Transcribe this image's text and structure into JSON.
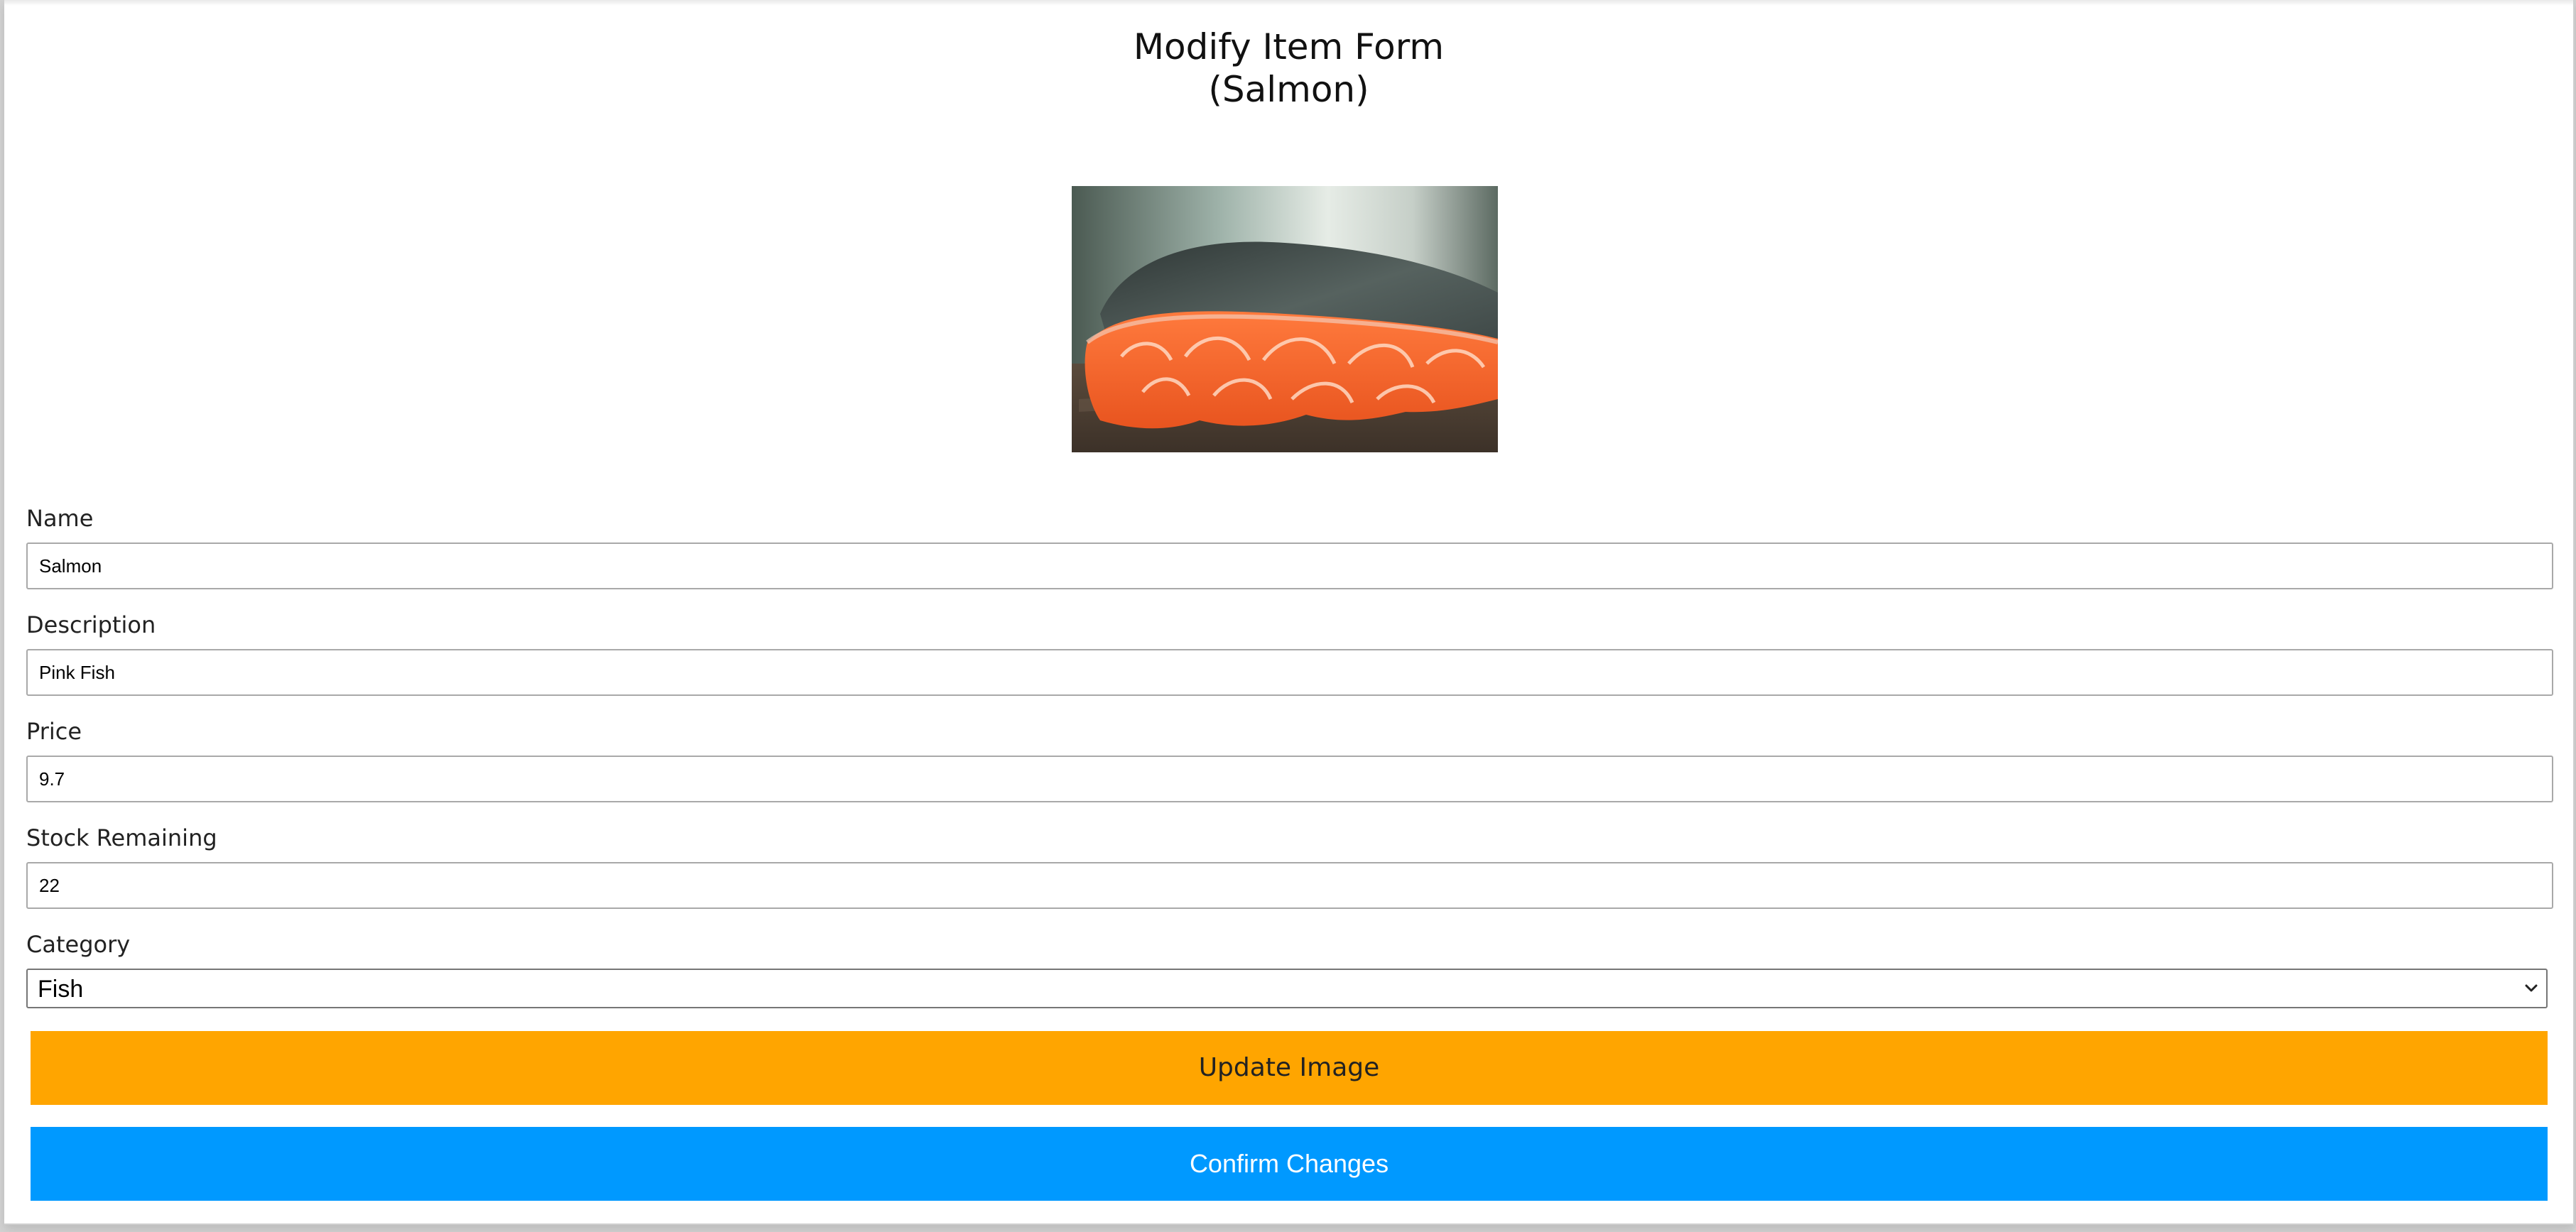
{
  "form": {
    "title_line1": "Modify Item Form",
    "title_line2": "(Salmon)",
    "image_alt": "Salmon",
    "fields": [
      {
        "label": "Name",
        "value": "Salmon"
      },
      {
        "label": "Description",
        "value": "Pink Fish"
      },
      {
        "label": "Price",
        "value": "9.7"
      },
      {
        "label": "Stock Remaining",
        "value": "22"
      }
    ],
    "category": {
      "label": "Category",
      "selected": "Fish"
    },
    "update_image_label": "Update Image",
    "confirm_label": "Confirm Changes"
  },
  "colors": {
    "update_button": "#ffa500",
    "confirm_button": "#0099ff",
    "background": "#ffffff"
  },
  "icons": {
    "select_arrow": "chevron-down-icon"
  }
}
